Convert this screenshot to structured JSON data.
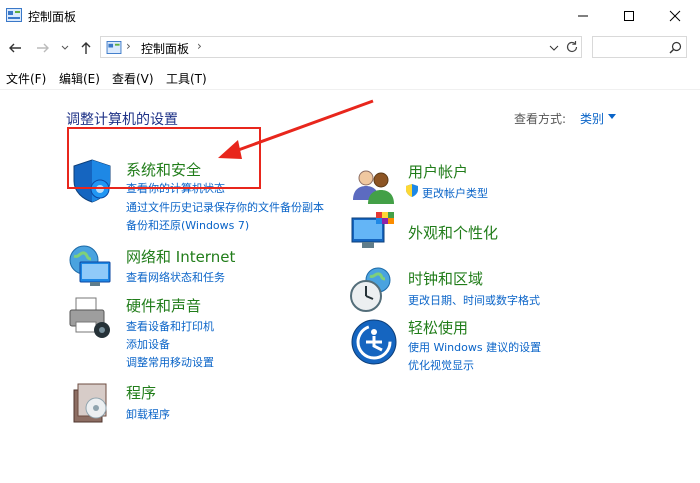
{
  "window": {
    "title": "控制面板"
  },
  "address": {
    "path": "控制面板",
    "separator": "›"
  },
  "menu": [
    "文件(F)",
    "编辑(E)",
    "查看(V)",
    "工具(T)"
  ],
  "page": {
    "heading": "调整计算机的设置",
    "view_label": "查看方式:",
    "view_value": "类别"
  },
  "left": [
    {
      "title": "系统和安全",
      "links": [
        "查看你的计算机状态",
        "通过文件历史记录保存你的文件备份副本",
        "备份和还原(Windows 7)"
      ]
    },
    {
      "title": "网络和 Internet",
      "links": [
        "查看网络状态和任务"
      ]
    },
    {
      "title": "硬件和声音",
      "links": [
        "查看设备和打印机",
        "添加设备",
        "调整常用移动设置"
      ]
    },
    {
      "title": "程序",
      "links": [
        "卸载程序"
      ]
    }
  ],
  "right": [
    {
      "title": "用户帐户",
      "links": [
        "更改帐户类型"
      ]
    },
    {
      "title": "外观和个性化",
      "links": []
    },
    {
      "title": "时钟和区域",
      "links": [
        "更改日期、时间或数字格式"
      ]
    },
    {
      "title": "轻松使用",
      "links": [
        "使用 Windows 建议的设置",
        "优化视觉显示"
      ]
    }
  ],
  "colors": {
    "heading": "#1e3287",
    "category": "#217d1a",
    "link": "#0a64c8",
    "annotation": "#e8261c"
  }
}
